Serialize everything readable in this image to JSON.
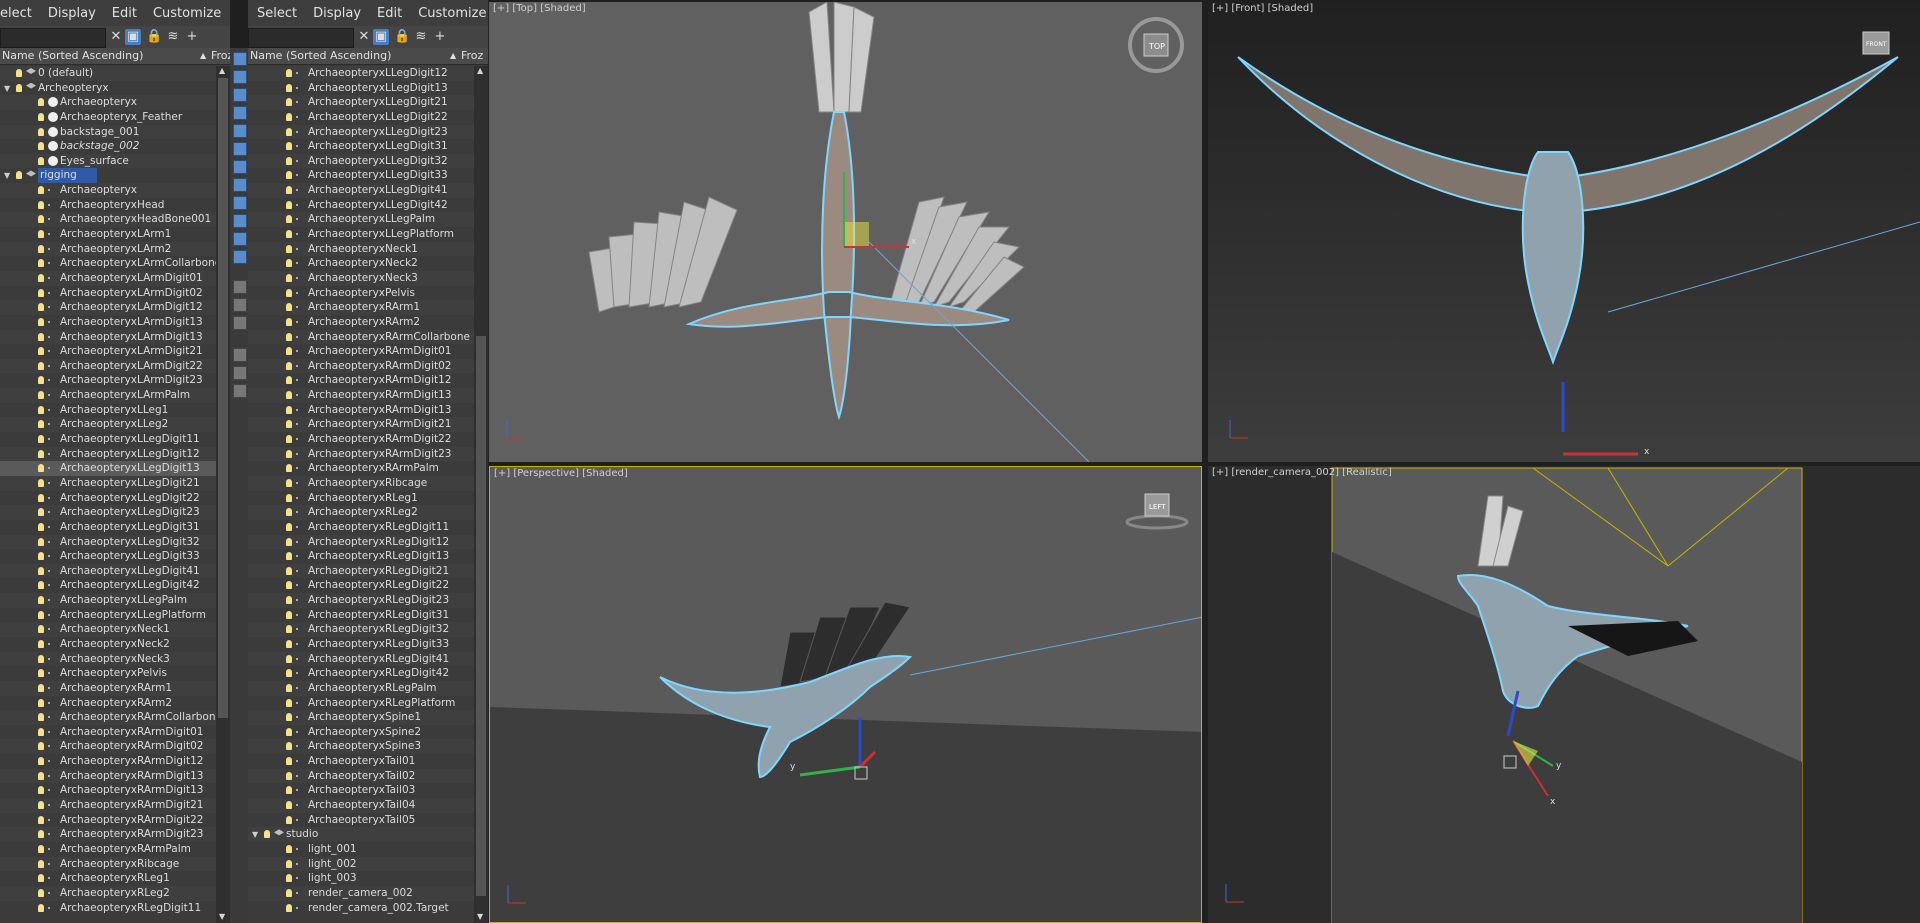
{
  "explorer_left": {
    "menu": [
      "elect",
      "Display",
      "Edit",
      "Customize"
    ],
    "column_header": "Name (Sorted Ascending)",
    "column_header2": "Froz",
    "rows": [
      {
        "label": "0 (default)",
        "indent": 1,
        "kind": "layer"
      },
      {
        "label": "Archeopteryx",
        "indent": 1,
        "kind": "layer",
        "expanded": true
      },
      {
        "label": "Archaeopteryx",
        "indent": 2,
        "kind": "ball"
      },
      {
        "label": "Archaeopteryx_Feather",
        "indent": 2,
        "kind": "ball"
      },
      {
        "label": "backstage_001",
        "indent": 2,
        "kind": "ball"
      },
      {
        "label": "backstage_002",
        "indent": 2,
        "kind": "ball",
        "italic": true
      },
      {
        "label": "Eyes_surface",
        "indent": 2,
        "kind": "ball"
      },
      {
        "label": "rigging",
        "indent": 1,
        "kind": "layer",
        "expanded": true,
        "highlight": true
      },
      {
        "label": "Archaeopteryx",
        "indent": 2,
        "kind": "bone"
      },
      {
        "label": "ArchaeopteryxHead",
        "indent": 2,
        "kind": "bone"
      },
      {
        "label": "ArchaeopteryxHeadBone001",
        "indent": 2,
        "kind": "bone"
      },
      {
        "label": "ArchaeopteryxLArm1",
        "indent": 2,
        "kind": "bone"
      },
      {
        "label": "ArchaeopteryxLArm2",
        "indent": 2,
        "kind": "bone"
      },
      {
        "label": "ArchaeopteryxLArmCollarbone",
        "indent": 2,
        "kind": "bone"
      },
      {
        "label": "ArchaeopteryxLArmDigit01",
        "indent": 2,
        "kind": "bone"
      },
      {
        "label": "ArchaeopteryxLArmDigit02",
        "indent": 2,
        "kind": "bone"
      },
      {
        "label": "ArchaeopteryxLArmDigit12",
        "indent": 2,
        "kind": "bone"
      },
      {
        "label": "ArchaeopteryxLArmDigit13",
        "indent": 2,
        "kind": "bone"
      },
      {
        "label": "ArchaeopteryxLArmDigit13",
        "indent": 2,
        "kind": "bone"
      },
      {
        "label": "ArchaeopteryxLArmDigit21",
        "indent": 2,
        "kind": "bone"
      },
      {
        "label": "ArchaeopteryxLArmDigit22",
        "indent": 2,
        "kind": "bone"
      },
      {
        "label": "ArchaeopteryxLArmDigit23",
        "indent": 2,
        "kind": "bone"
      },
      {
        "label": "ArchaeopteryxLArmPalm",
        "indent": 2,
        "kind": "bone"
      },
      {
        "label": "ArchaeopteryxLLeg1",
        "indent": 2,
        "kind": "bone"
      },
      {
        "label": "ArchaeopteryxLLeg2",
        "indent": 2,
        "kind": "bone"
      },
      {
        "label": "ArchaeopteryxLLegDigit11",
        "indent": 2,
        "kind": "bone"
      },
      {
        "label": "ArchaeopteryxLLegDigit12",
        "indent": 2,
        "kind": "bone"
      },
      {
        "label": "ArchaeopteryxLLegDigit13",
        "indent": 2,
        "kind": "bone",
        "selected": true
      },
      {
        "label": "ArchaeopteryxLLegDigit21",
        "indent": 2,
        "kind": "bone"
      },
      {
        "label": "ArchaeopteryxLLegDigit22",
        "indent": 2,
        "kind": "bone"
      },
      {
        "label": "ArchaeopteryxLLegDigit23",
        "indent": 2,
        "kind": "bone"
      },
      {
        "label": "ArchaeopteryxLLegDigit31",
        "indent": 2,
        "kind": "bone"
      },
      {
        "label": "ArchaeopteryxLLegDigit32",
        "indent": 2,
        "kind": "bone"
      },
      {
        "label": "ArchaeopteryxLLegDigit33",
        "indent": 2,
        "kind": "bone"
      },
      {
        "label": "ArchaeopteryxLLegDigit41",
        "indent": 2,
        "kind": "bone"
      },
      {
        "label": "ArchaeopteryxLLegDigit42",
        "indent": 2,
        "kind": "bone"
      },
      {
        "label": "ArchaeopteryxLLegPalm",
        "indent": 2,
        "kind": "bone"
      },
      {
        "label": "ArchaeopteryxLLegPlatform",
        "indent": 2,
        "kind": "bone"
      },
      {
        "label": "ArchaeopteryxNeck1",
        "indent": 2,
        "kind": "bone"
      },
      {
        "label": "ArchaeopteryxNeck2",
        "indent": 2,
        "kind": "bone"
      },
      {
        "label": "ArchaeopteryxNeck3",
        "indent": 2,
        "kind": "bone"
      },
      {
        "label": "ArchaeopteryxPelvis",
        "indent": 2,
        "kind": "bone"
      },
      {
        "label": "ArchaeopteryxRArm1",
        "indent": 2,
        "kind": "bone"
      },
      {
        "label": "ArchaeopteryxRArm2",
        "indent": 2,
        "kind": "bone"
      },
      {
        "label": "ArchaeopteryxRArmCollarbone",
        "indent": 2,
        "kind": "bone"
      },
      {
        "label": "ArchaeopteryxRArmDigit01",
        "indent": 2,
        "kind": "bone"
      },
      {
        "label": "ArchaeopteryxRArmDigit02",
        "indent": 2,
        "kind": "bone"
      },
      {
        "label": "ArchaeopteryxRArmDigit12",
        "indent": 2,
        "kind": "bone"
      },
      {
        "label": "ArchaeopteryxRArmDigit13",
        "indent": 2,
        "kind": "bone"
      },
      {
        "label": "ArchaeopteryxRArmDigit13",
        "indent": 2,
        "kind": "bone"
      },
      {
        "label": "ArchaeopteryxRArmDigit21",
        "indent": 2,
        "kind": "bone"
      },
      {
        "label": "ArchaeopteryxRArmDigit22",
        "indent": 2,
        "kind": "bone"
      },
      {
        "label": "ArchaeopteryxRArmDigit23",
        "indent": 2,
        "kind": "bone"
      },
      {
        "label": "ArchaeopteryxRArmPalm",
        "indent": 2,
        "kind": "bone"
      },
      {
        "label": "ArchaeopteryxRibcage",
        "indent": 2,
        "kind": "bone"
      },
      {
        "label": "ArchaeopteryxRLeg1",
        "indent": 2,
        "kind": "bone"
      },
      {
        "label": "ArchaeopteryxRLeg2",
        "indent": 2,
        "kind": "bone"
      },
      {
        "label": "ArchaeopteryxRLegDigit11",
        "indent": 2,
        "kind": "bone"
      }
    ]
  },
  "explorer_right": {
    "menu": [
      "Select",
      "Display",
      "Edit",
      "Customize"
    ],
    "column_header": "Name (Sorted Ascending)",
    "column_header2": "Froz",
    "rows": [
      {
        "label": "ArchaeopteryxLLegDigit12",
        "indent": 2,
        "kind": "bone"
      },
      {
        "label": "ArchaeopteryxLLegDigit13",
        "indent": 2,
        "kind": "bone"
      },
      {
        "label": "ArchaeopteryxLLegDigit21",
        "indent": 2,
        "kind": "bone"
      },
      {
        "label": "ArchaeopteryxLLegDigit22",
        "indent": 2,
        "kind": "bone"
      },
      {
        "label": "ArchaeopteryxLLegDigit23",
        "indent": 2,
        "kind": "bone"
      },
      {
        "label": "ArchaeopteryxLLegDigit31",
        "indent": 2,
        "kind": "bone"
      },
      {
        "label": "ArchaeopteryxLLegDigit32",
        "indent": 2,
        "kind": "bone"
      },
      {
        "label": "ArchaeopteryxLLegDigit33",
        "indent": 2,
        "kind": "bone"
      },
      {
        "label": "ArchaeopteryxLLegDigit41",
        "indent": 2,
        "kind": "bone"
      },
      {
        "label": "ArchaeopteryxLLegDigit42",
        "indent": 2,
        "kind": "bone"
      },
      {
        "label": "ArchaeopteryxLLegPalm",
        "indent": 2,
        "kind": "bone"
      },
      {
        "label": "ArchaeopteryxLLegPlatform",
        "indent": 2,
        "kind": "bone"
      },
      {
        "label": "ArchaeopteryxNeck1",
        "indent": 2,
        "kind": "bone"
      },
      {
        "label": "ArchaeopteryxNeck2",
        "indent": 2,
        "kind": "bone"
      },
      {
        "label": "ArchaeopteryxNeck3",
        "indent": 2,
        "kind": "bone"
      },
      {
        "label": "ArchaeopteryxPelvis",
        "indent": 2,
        "kind": "bone"
      },
      {
        "label": "ArchaeopteryxRArm1",
        "indent": 2,
        "kind": "bone"
      },
      {
        "label": "ArchaeopteryxRArm2",
        "indent": 2,
        "kind": "bone"
      },
      {
        "label": "ArchaeopteryxRArmCollarbone",
        "indent": 2,
        "kind": "bone"
      },
      {
        "label": "ArchaeopteryxRArmDigit01",
        "indent": 2,
        "kind": "bone"
      },
      {
        "label": "ArchaeopteryxRArmDigit02",
        "indent": 2,
        "kind": "bone"
      },
      {
        "label": "ArchaeopteryxRArmDigit12",
        "indent": 2,
        "kind": "bone"
      },
      {
        "label": "ArchaeopteryxRArmDigit13",
        "indent": 2,
        "kind": "bone"
      },
      {
        "label": "ArchaeopteryxRArmDigit13",
        "indent": 2,
        "kind": "bone"
      },
      {
        "label": "ArchaeopteryxRArmDigit21",
        "indent": 2,
        "kind": "bone"
      },
      {
        "label": "ArchaeopteryxRArmDigit22",
        "indent": 2,
        "kind": "bone"
      },
      {
        "label": "ArchaeopteryxRArmDigit23",
        "indent": 2,
        "kind": "bone"
      },
      {
        "label": "ArchaeopteryxRArmPalm",
        "indent": 2,
        "kind": "bone"
      },
      {
        "label": "ArchaeopteryxRibcage",
        "indent": 2,
        "kind": "bone"
      },
      {
        "label": "ArchaeopteryxRLeg1",
        "indent": 2,
        "kind": "bone"
      },
      {
        "label": "ArchaeopteryxRLeg2",
        "indent": 2,
        "kind": "bone"
      },
      {
        "label": "ArchaeopteryxRLegDigit11",
        "indent": 2,
        "kind": "bone"
      },
      {
        "label": "ArchaeopteryxRLegDigit12",
        "indent": 2,
        "kind": "bone"
      },
      {
        "label": "ArchaeopteryxRLegDigit13",
        "indent": 2,
        "kind": "bone"
      },
      {
        "label": "ArchaeopteryxRLegDigit21",
        "indent": 2,
        "kind": "bone"
      },
      {
        "label": "ArchaeopteryxRLegDigit22",
        "indent": 2,
        "kind": "bone"
      },
      {
        "label": "ArchaeopteryxRLegDigit23",
        "indent": 2,
        "kind": "bone"
      },
      {
        "label": "ArchaeopteryxRLegDigit31",
        "indent": 2,
        "kind": "bone"
      },
      {
        "label": "ArchaeopteryxRLegDigit32",
        "indent": 2,
        "kind": "bone"
      },
      {
        "label": "ArchaeopteryxRLegDigit33",
        "indent": 2,
        "kind": "bone"
      },
      {
        "label": "ArchaeopteryxRLegDigit41",
        "indent": 2,
        "kind": "bone"
      },
      {
        "label": "ArchaeopteryxRLegDigit42",
        "indent": 2,
        "kind": "bone"
      },
      {
        "label": "ArchaeopteryxRLegPalm",
        "indent": 2,
        "kind": "bone"
      },
      {
        "label": "ArchaeopteryxRLegPlatform",
        "indent": 2,
        "kind": "bone"
      },
      {
        "label": "ArchaeopteryxSpine1",
        "indent": 2,
        "kind": "bone"
      },
      {
        "label": "ArchaeopteryxSpine2",
        "indent": 2,
        "kind": "bone"
      },
      {
        "label": "ArchaeopteryxSpine3",
        "indent": 2,
        "kind": "bone"
      },
      {
        "label": "ArchaeopteryxTail01",
        "indent": 2,
        "kind": "bone"
      },
      {
        "label": "ArchaeopteryxTail02",
        "indent": 2,
        "kind": "bone"
      },
      {
        "label": "ArchaeopteryxTail03",
        "indent": 2,
        "kind": "bone"
      },
      {
        "label": "ArchaeopteryxTail04",
        "indent": 2,
        "kind": "bone"
      },
      {
        "label": "ArchaeopteryxTail05",
        "indent": 2,
        "kind": "bone"
      },
      {
        "label": "studio",
        "indent": 1,
        "kind": "layer",
        "expanded": true
      },
      {
        "label": "light_001",
        "indent": 2,
        "kind": "light"
      },
      {
        "label": "light_002",
        "indent": 2,
        "kind": "light"
      },
      {
        "label": "light_003",
        "indent": 2,
        "kind": "light"
      },
      {
        "label": "render_camera_002",
        "indent": 2,
        "kind": "camera"
      },
      {
        "label": "render_camera_002.Target",
        "indent": 2,
        "kind": "camera"
      }
    ]
  },
  "viewports": {
    "top": {
      "label": "[+] [Top] [Shaded]",
      "cube": "TOP"
    },
    "front": {
      "label": "[+] [Front] [Shaded]",
      "cube": "FRONT"
    },
    "perspective": {
      "label": "[+] [Perspective] [Shaded]",
      "cube": "LEFT"
    },
    "camera": {
      "label": "[+] [render_camera_002] [Realistic]"
    }
  },
  "colors": {
    "viewport_bg": "#5f5f5f",
    "front_bg": "#2d2d2d",
    "active_border": "#c8b400",
    "bird_outline": "#7fd6ff"
  }
}
